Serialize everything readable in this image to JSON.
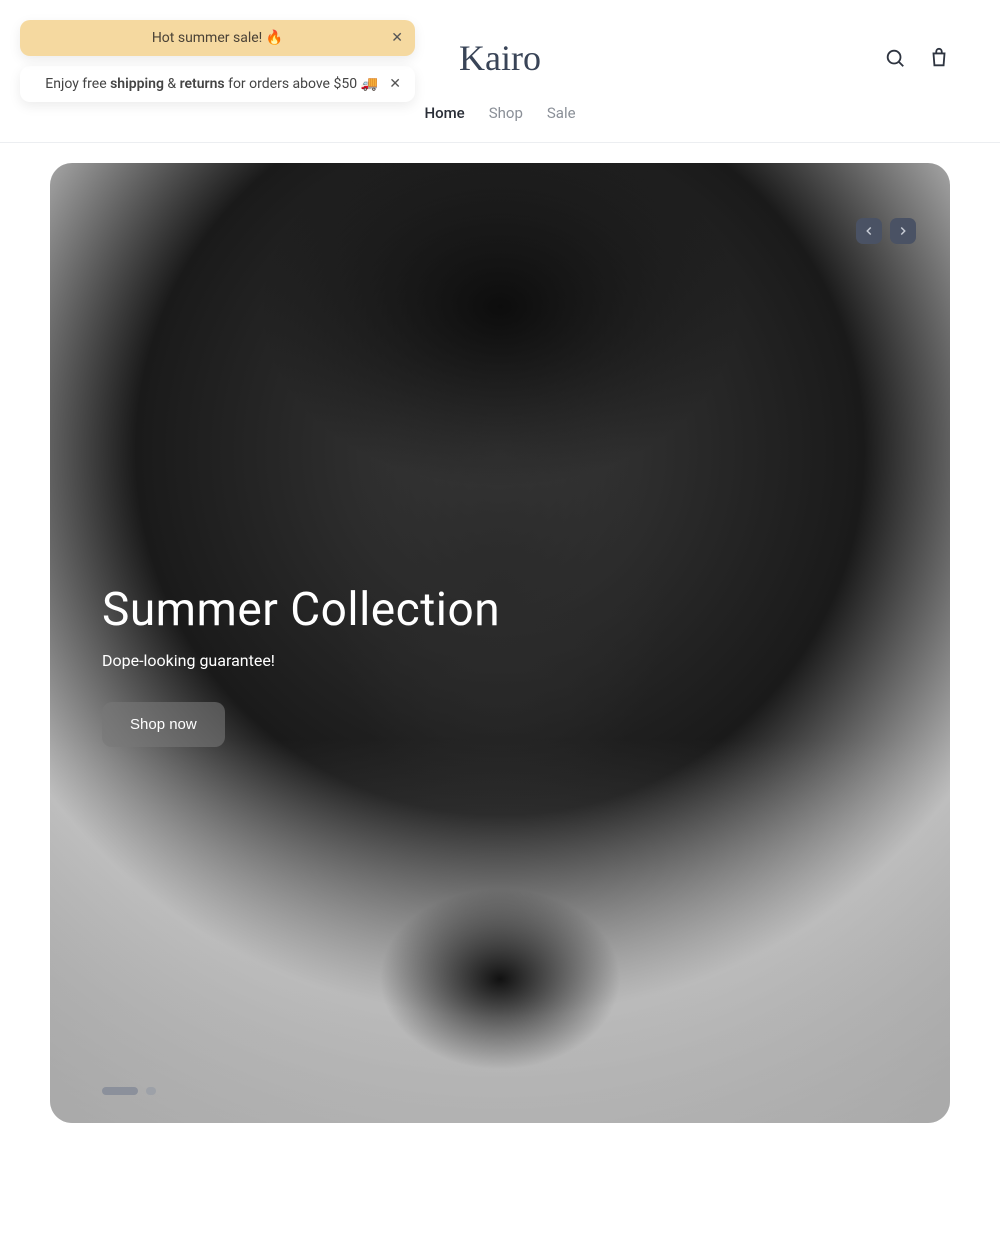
{
  "toasts": {
    "summerSale": "Hot summer sale! 🔥",
    "freeShip": {
      "prefix": "Enjoy free ",
      "b1": "shipping",
      "amp": " & ",
      "b2": "returns",
      "suffix": " for orders above $50 🚚"
    }
  },
  "brand": "Kairo",
  "nav": {
    "home": "Home",
    "shop": "Shop",
    "sale": "Sale"
  },
  "hero": {
    "title": "Summer Collection",
    "subtitle": "Dope-looking guarantee!",
    "cta": "Shop now"
  }
}
